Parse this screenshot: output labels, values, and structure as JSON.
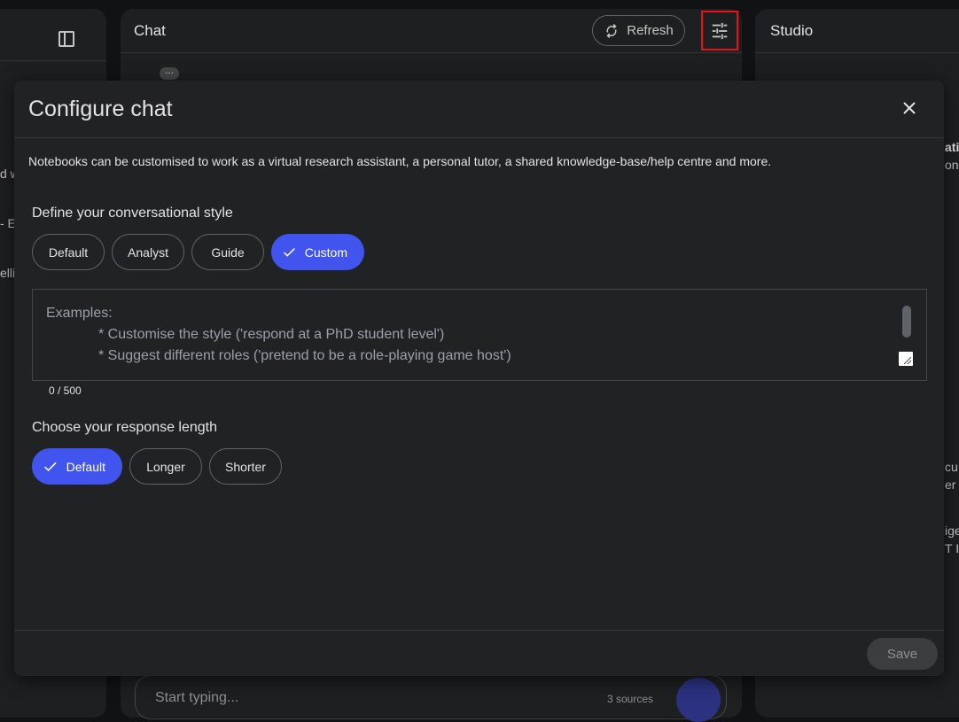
{
  "background_panels": {
    "chat": {
      "title": "Chat",
      "refresh_label": "Refresh",
      "input_placeholder": "Start typing...",
      "sources_count": "3 sources"
    },
    "studio": {
      "title": "Studio"
    },
    "left_fragments": [
      "d w",
      "- E",
      "elli"
    ],
    "right_fragments": [
      "ati",
      "on",
      "cu",
      "er",
      "ige",
      "T I"
    ]
  },
  "modal": {
    "title": "Configure chat",
    "description": "Notebooks can be customised to work as a virtual research assistant, a personal tutor, a shared knowledge-base/help centre and more.",
    "style_section": {
      "title": "Define your conversational style",
      "options": [
        {
          "label": "Default",
          "selected": false
        },
        {
          "label": "Analyst",
          "selected": false
        },
        {
          "label": "Guide",
          "selected": false
        },
        {
          "label": "Custom",
          "selected": true
        }
      ]
    },
    "custom_prompt": {
      "value": "",
      "placeholder_lines": [
        "Examples:",
        "* Customise the style ('respond at a PhD student level')",
        "* Suggest different roles ('pretend to be a role-playing game host')"
      ],
      "char_count": "0 / 500"
    },
    "length_section": {
      "title": "Choose your response length",
      "options": [
        {
          "label": "Default",
          "selected": true
        },
        {
          "label": "Longer",
          "selected": false
        },
        {
          "label": "Shorter",
          "selected": false
        }
      ]
    },
    "save_label": "Save"
  },
  "colors": {
    "accent": "#4154ee",
    "highlight_border": "#e8101a",
    "modal_bg": "#212224"
  }
}
